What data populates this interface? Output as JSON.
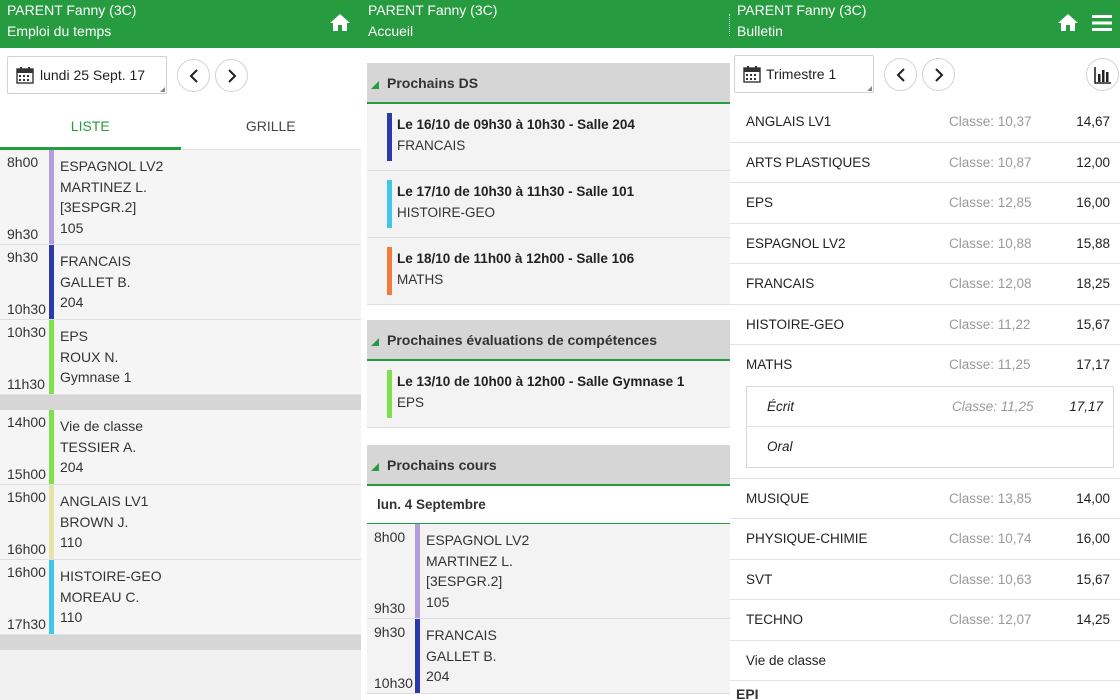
{
  "colors": {
    "brand": "#279b3f"
  },
  "panel1": {
    "header": {
      "user": "PARENT Fanny (3C)",
      "subtitle": "Emploi du temps",
      "home_icon": "home-icon"
    },
    "date": "lundi 25 Sept. 17",
    "tabs": [
      {
        "label": "LISTE",
        "active": true
      },
      {
        "label": "GRILLE",
        "active": false
      }
    ],
    "lessons": [
      {
        "start": "8h00",
        "end": "9h30",
        "color": "#b39ddb",
        "lines": [
          "ESPAGNOL LV2",
          "MARTINEZ L.",
          "[3ESPGR.2]",
          "105"
        ]
      },
      {
        "start": "9h30",
        "end": "10h30",
        "color": "#2b3aa8",
        "lines": [
          "FRANCAIS",
          "GALLET B.",
          "204"
        ]
      },
      {
        "start": "10h30",
        "end": "11h30",
        "color": "#7ee04a",
        "lines": [
          "EPS",
          "ROUX N.",
          "Gymnase 1"
        ]
      },
      {
        "gap": true
      },
      {
        "start": "14h00",
        "end": "15h00",
        "color": "#7ee04a",
        "lines": [
          "Vie de classe",
          "TESSIER A.",
          "204"
        ]
      },
      {
        "start": "15h00",
        "end": "16h00",
        "color": "#e5e3a8",
        "lines": [
          "ANGLAIS LV1",
          "BROWN J.",
          "110"
        ]
      },
      {
        "start": "16h00",
        "end": "17h30",
        "color": "#3fc6ea",
        "lines": [
          "HISTOIRE-GEO",
          "MOREAU C.",
          "110"
        ]
      },
      {
        "gap": true
      }
    ]
  },
  "panel2": {
    "header": {
      "user": "PARENT Fanny (3C)",
      "subtitle": "Accueil"
    },
    "ds": {
      "title": "Prochains DS",
      "items": [
        {
          "title": "Le 16/10 de 09h30 à 10h30 - Salle 204",
          "subject": "FRANCAIS",
          "color": "#2b3aa8"
        },
        {
          "title": "Le 17/10 de 10h30 à 11h30 - Salle 101",
          "subject": "HISTOIRE-GEO",
          "color": "#3fc6ea"
        },
        {
          "title": "Le 18/10 de 11h00 à 12h00 - Salle 106",
          "subject": "MATHS",
          "color": "#f27a3a"
        }
      ]
    },
    "evals": {
      "title": "Prochaines évaluations de compétences",
      "items": [
        {
          "title": "Le 13/10 de 10h00 à 12h00 - Salle Gymnase 1",
          "subject": "EPS",
          "color": "#7ee04a"
        }
      ]
    },
    "cours": {
      "title": "Prochains cours",
      "day": "lun. 4 Septembre",
      "lessons": [
        {
          "start": "8h00",
          "end": "9h30",
          "color": "#b39ddb",
          "lines": [
            "ESPAGNOL LV2",
            "MARTINEZ L.",
            "[3ESPGR.2]",
            "105"
          ]
        },
        {
          "start": "9h30",
          "end": "10h30",
          "color": "#2b3aa8",
          "lines": [
            "FRANCAIS",
            "GALLET B.",
            "204"
          ]
        }
      ]
    }
  },
  "panel3": {
    "header": {
      "user": "PARENT Fanny (3C)",
      "subtitle": "Bulletin"
    },
    "period": "Trimestre 1",
    "grades": [
      {
        "subject": "ANGLAIS LV1",
        "class_avg": "Classe: 10,37",
        "grade": "14,67"
      },
      {
        "subject": "ARTS PLASTIQUES",
        "class_avg": "Classe: 10,87",
        "grade": "12,00"
      },
      {
        "subject": "EPS",
        "class_avg": "Classe: 12,85",
        "grade": "16,00"
      },
      {
        "subject": "ESPAGNOL LV2",
        "class_avg": "Classe: 10,88",
        "grade": "15,88"
      },
      {
        "subject": "FRANCAIS",
        "class_avg": "Classe: 12,08",
        "grade": "18,25"
      },
      {
        "subject": "HISTOIRE-GEO",
        "class_avg": "Classe: 11,22",
        "grade": "15,67"
      },
      {
        "subject": "MATHS",
        "class_avg": "Classe: 11,25",
        "grade": "17,17",
        "sub": [
          {
            "label": "Écrit",
            "class_avg": "Classe: 11,25",
            "grade": "17,17"
          },
          {
            "label": "Oral",
            "class_avg": "",
            "grade": ""
          }
        ]
      },
      {
        "subject": "MUSIQUE",
        "class_avg": "Classe: 13,85",
        "grade": "14,00"
      },
      {
        "subject": "PHYSIQUE-CHIMIE",
        "class_avg": "Classe: 10,74",
        "grade": "16,00"
      },
      {
        "subject": "SVT",
        "class_avg": "Classe: 10,63",
        "grade": "15,67"
      },
      {
        "subject": "TECHNO",
        "class_avg": "Classe: 12,07",
        "grade": "14,25"
      },
      {
        "subject": "Vie de classe",
        "class_avg": "",
        "grade": ""
      }
    ],
    "epi_label": "EPI"
  }
}
